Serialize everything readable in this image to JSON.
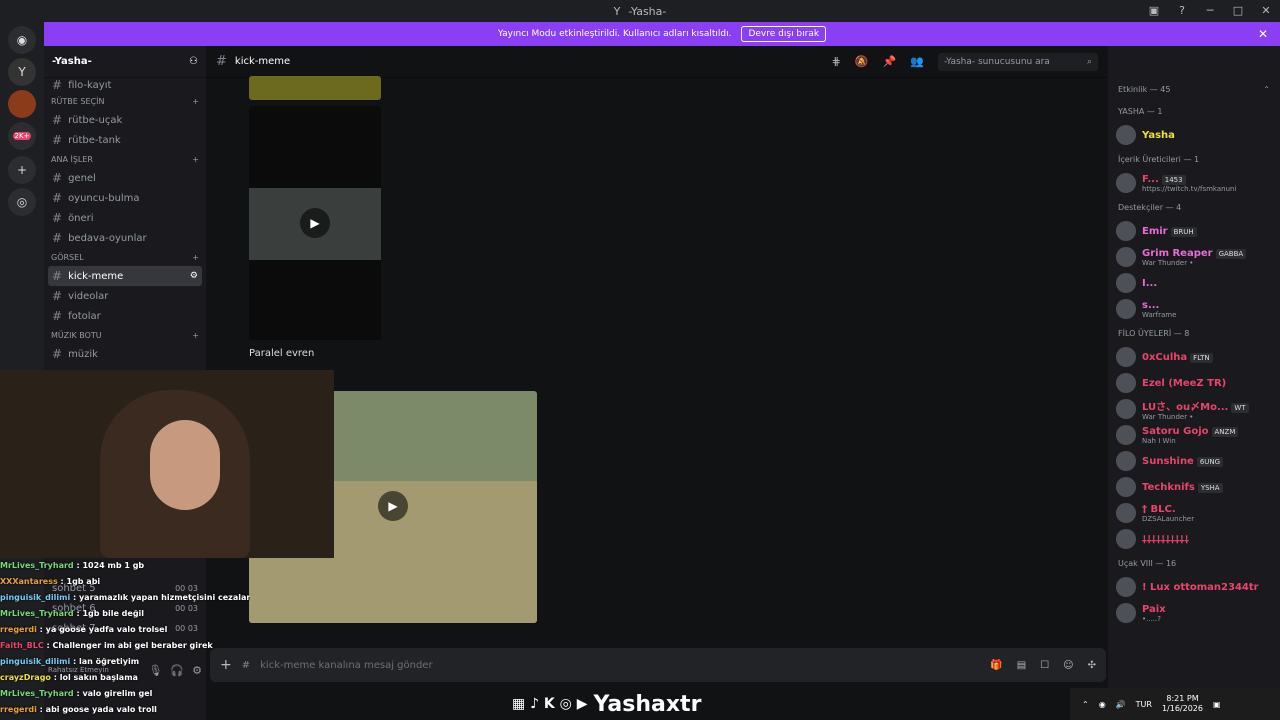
{
  "titlebar": {
    "icon": "Y",
    "title": "-Yasha-"
  },
  "banner": {
    "text": "Yayıncı Modu etkinleştirildi. Kullanıcı adları kısaltıldı.",
    "button": "Devre dışı bırak"
  },
  "rail": {
    "badge": "2K+"
  },
  "sidebar": {
    "server_name": "-Yasha-",
    "items": [
      {
        "type": "channel",
        "label": "filo-kayıt"
      },
      {
        "type": "category",
        "label": "RÜTBE SEÇİN"
      },
      {
        "type": "channel",
        "label": "rütbe-uçak"
      },
      {
        "type": "channel",
        "label": "rütbe-tank"
      },
      {
        "type": "category",
        "label": "ANA İŞLER"
      },
      {
        "type": "channel",
        "label": "genel"
      },
      {
        "type": "channel",
        "label": "oyuncu-bulma"
      },
      {
        "type": "channel",
        "label": "öneri"
      },
      {
        "type": "channel",
        "label": "bedava-oyunlar"
      },
      {
        "type": "category",
        "label": "GÖRSEL"
      },
      {
        "type": "channel",
        "label": "kick-meme",
        "active": true
      },
      {
        "type": "channel",
        "label": "videolar"
      },
      {
        "type": "channel",
        "label": "fotolar"
      },
      {
        "type": "category",
        "label": "müzik botu"
      },
      {
        "type": "channel",
        "label": "müzik"
      }
    ],
    "voice": [
      "sohbet 5",
      "sohbet 6",
      "sohbet 7"
    ],
    "voice_counts": [
      [
        "00",
        "03"
      ],
      [
        "00",
        "03"
      ],
      [
        "00",
        "03"
      ]
    ],
    "user_status": "Rahatsız Etmeyin"
  },
  "header": {
    "channel": "kick-meme",
    "search_placeholder": "-Yasha- sunucusunu ara"
  },
  "messages": {
    "caption": "Paralel evren"
  },
  "composer": {
    "placeholder": "kick-meme kanalına mesaj gönder"
  },
  "members": {
    "activity": "Etkinlik — 45",
    "groups": [
      {
        "title": "YASHA — 1",
        "members": [
          {
            "name": "Yasha",
            "color": "#f0e13a",
            "tag": "",
            "sub": ""
          }
        ]
      },
      {
        "title": "İçerik Üreticileri — 1",
        "members": [
          {
            "name": "F...",
            "color": "#e8456b",
            "tag": "1453",
            "sub": "https://twitch.tv/fsmkanuni"
          }
        ]
      },
      {
        "title": "Destekçiler — 4",
        "members": [
          {
            "name": "Emir",
            "color": "#e86bd6",
            "tag": "BRUH",
            "sub": ""
          },
          {
            "name": "Grim Reaper",
            "color": "#e86bd6",
            "tag": "GABBA",
            "sub": "War Thunder •"
          },
          {
            "name": "I...",
            "color": "#e86bd6",
            "tag": "",
            "sub": ""
          },
          {
            "name": "s...",
            "color": "#e86bd6",
            "tag": "",
            "sub": "Warframe"
          }
        ]
      },
      {
        "title": "FİLO ÜYELERİ — 8",
        "members": [
          {
            "name": "0xCulha",
            "color": "#e8456b",
            "tag": "FLTN",
            "sub": ""
          },
          {
            "name": "Ezel (MeeZ TR)",
            "color": "#e8456b",
            "tag": "",
            "sub": ""
          },
          {
            "name": "LUさ、ou〆Mo...",
            "color": "#e8456b",
            "tag": "WT",
            "sub": "War Thunder •"
          },
          {
            "name": "Satoru Gojo",
            "color": "#e8456b",
            "tag": "ANZM",
            "sub": "Nah I Win"
          },
          {
            "name": "Sunshine",
            "color": "#e8456b",
            "tag": "6UNG",
            "sub": ""
          },
          {
            "name": "Techknifs",
            "color": "#e8456b",
            "tag": "YSHA",
            "sub": ""
          },
          {
            "name": "† BLC.",
            "color": "#e8456b",
            "tag": "",
            "sub": "DZSALauncher"
          },
          {
            "name": "⸸⸸⸸⸸⸸⸸⸸⸸⸸⸸",
            "color": "#e8456b",
            "tag": "",
            "sub": ""
          }
        ]
      },
      {
        "title": "Uçak VIII — 16",
        "members": [
          {
            "name": "! Lux ottoman2344tr",
            "color": "#e8456b",
            "tag": "",
            "sub": ""
          },
          {
            "name": "Paix",
            "color": "#e8456b",
            "tag": "",
            "sub": "•.....?"
          }
        ]
      }
    ]
  },
  "chat": [
    {
      "user": "MrLives_Tryhard",
      "color": "#7cd67c",
      "text": "1024 mb 1 gb"
    },
    {
      "user": "XXXantaress",
      "color": "#e8a23a",
      "text": "1gb abi"
    },
    {
      "user": "pinguisik_dilimi",
      "color": "#7cc9f0",
      "text": "yaramazlık yapan hizmetçisini cezalandırdı"
    },
    {
      "user": "MrLives_Tryhard",
      "color": "#7cd67c",
      "text": "1gb bile değil"
    },
    {
      "user": "rregerdi",
      "color": "#e8a23a",
      "text": "ya goose yadfa valo trolsel"
    },
    {
      "user": "Faith_BLC",
      "color": "#e8456b",
      "text": "Challenger im abi gel beraber girek"
    },
    {
      "user": "pinguisik_dilimi",
      "color": "#7cc9f0",
      "text": "lan öğretiyim"
    },
    {
      "user": "crayzDrago",
      "color": "#f0e13a",
      "text": "lol sakın başlama"
    },
    {
      "user": "MrLives_Tryhard",
      "color": "#7cd67c",
      "text": "valo girelim gel"
    },
    {
      "user": "rregerdi",
      "color": "#e8a23a",
      "text": "abi goose yada valo troll"
    }
  ],
  "brand": {
    "text": "Yashaxtr"
  },
  "taskbar": {
    "lang": "TUR",
    "time": "8:21 PM",
    "date": "1/16/2026"
  }
}
